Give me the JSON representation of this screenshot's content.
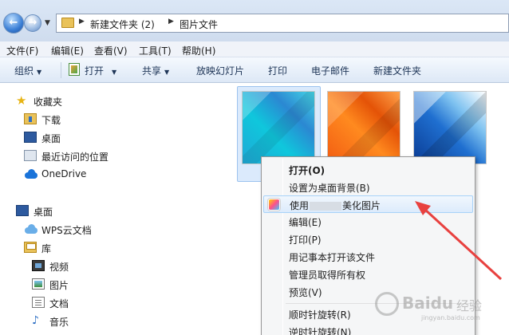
{
  "address": {
    "breadcrumbs": [
      "新建文件夹 (2)",
      "图片文件"
    ]
  },
  "menubar": {
    "items": [
      "文件(F)",
      "编辑(E)",
      "查看(V)",
      "工具(T)",
      "帮助(H)"
    ]
  },
  "toolbar": {
    "items": [
      "组织",
      "打开",
      "共享",
      "放映幻灯片",
      "打印",
      "电子邮件",
      "新建文件夹"
    ]
  },
  "navpane": {
    "favorites": {
      "label": "收藏夹",
      "items": [
        "下载",
        "桌面",
        "最近访问的位置",
        "OneDrive"
      ]
    },
    "desktop": {
      "label": "桌面",
      "items": [
        "WPS云文档",
        "库"
      ],
      "library_items": [
        "视频",
        "图片",
        "文档",
        "音乐"
      ]
    }
  },
  "context_menu": {
    "items": [
      {
        "label": "打开(O)",
        "bold": true
      },
      {
        "label": "设置为桌面背景(B)"
      },
      {
        "label_prefix": "使用",
        "label_suffix": "美化图片",
        "hover": true,
        "icon": "meitu-icon"
      },
      {
        "label": "编辑(E)"
      },
      {
        "label": "打印(P)"
      },
      {
        "label": "用记事本打开该文件"
      },
      {
        "label": "管理员取得所有权"
      },
      {
        "label": "预览(V)"
      },
      {
        "label": "顺时针旋转(R)"
      },
      {
        "label": "逆时针旋转(N)"
      }
    ]
  },
  "watermark": {
    "brand": "Baidu",
    "sub": "经验",
    "url": "jingyan.baidu.com"
  },
  "colors": {
    "accent": "#e8413f",
    "hover_border": "#a8d2f8",
    "selection": "#dbeafc"
  }
}
